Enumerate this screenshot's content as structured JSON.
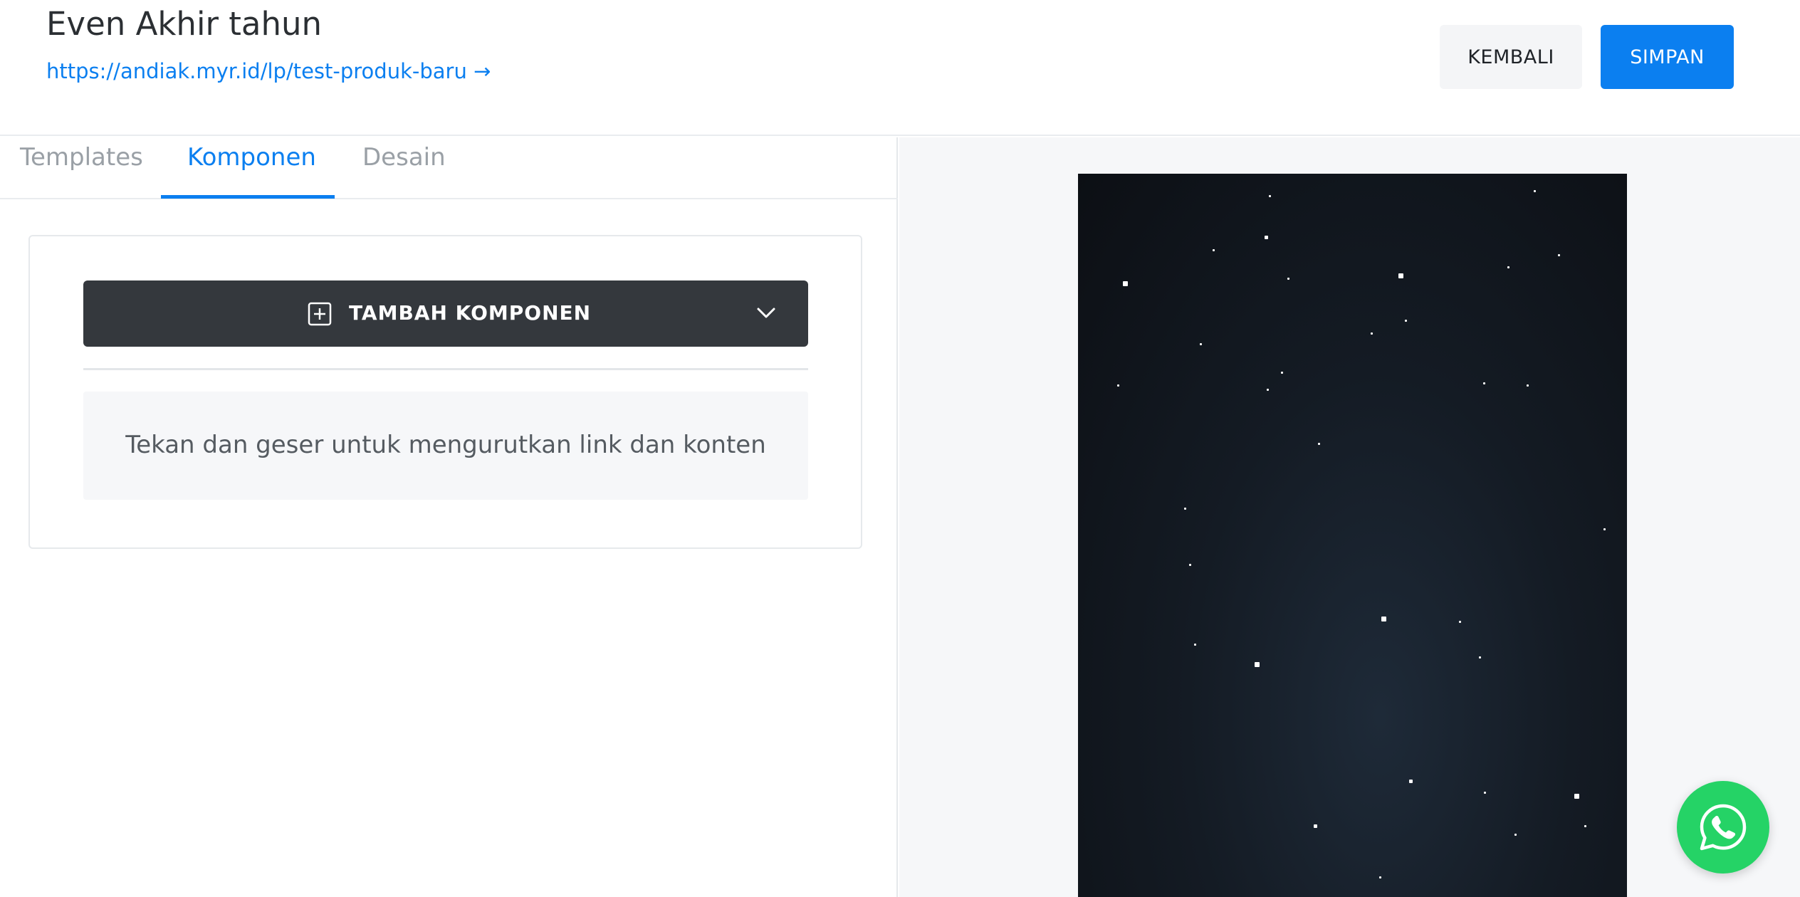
{
  "header": {
    "title": "Even Akhir tahun",
    "url": "https://andiak.myr.id/lp/test-produk-baru →",
    "back_label": "KEMBALI",
    "save_label": "SIMPAN"
  },
  "tabs": [
    {
      "label": "Templates",
      "active": false
    },
    {
      "label": "Komponen",
      "active": true
    },
    {
      "label": "Desain",
      "active": false
    }
  ],
  "components_panel": {
    "add_button_label": "TAMBAH KOMPONEN",
    "add_button_icon": "plus-square-icon",
    "dropdown_icon": "chevron-down-icon",
    "hint": "Tekan dan geser untuk mengurutkan link dan konten"
  },
  "preview": {
    "background": "starry-night",
    "colors": {
      "dark": "#0c0f14",
      "mid": "#1e2a38",
      "star": "#ffffff"
    }
  },
  "floating_button": {
    "icon": "whatsapp-icon",
    "color": "#25d366"
  },
  "colors": {
    "accent": "#0b7ff0",
    "dark_button": "#34383d"
  }
}
